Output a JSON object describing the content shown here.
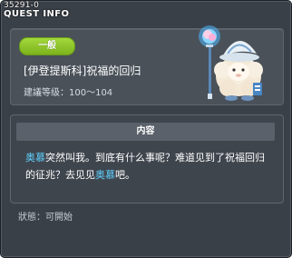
{
  "quest": {
    "id_label": "35291-0",
    "window_title": "QUEST INFO",
    "level_badge": "一般",
    "name": "[伊登提斯科]祝福的回归",
    "level_range": "建議等级：100～104",
    "content_header": "内容",
    "content": {
      "npc_name_1": "奥慕",
      "text_1": "突然叫我。到底有什么事呢？难道见到了祝福回归的征兆？去见见",
      "npc_name_2": "奥慕",
      "text_2": "吧。"
    },
    "status": "狀態：可開始"
  },
  "colors": {
    "window_bg": "#3a4048",
    "panel_bg": "#4a5159",
    "badge_green": "#8ac426",
    "npc_link": "#5fd1ff"
  },
  "icons": {
    "npc": "npc-portrait-sheep-mage"
  }
}
